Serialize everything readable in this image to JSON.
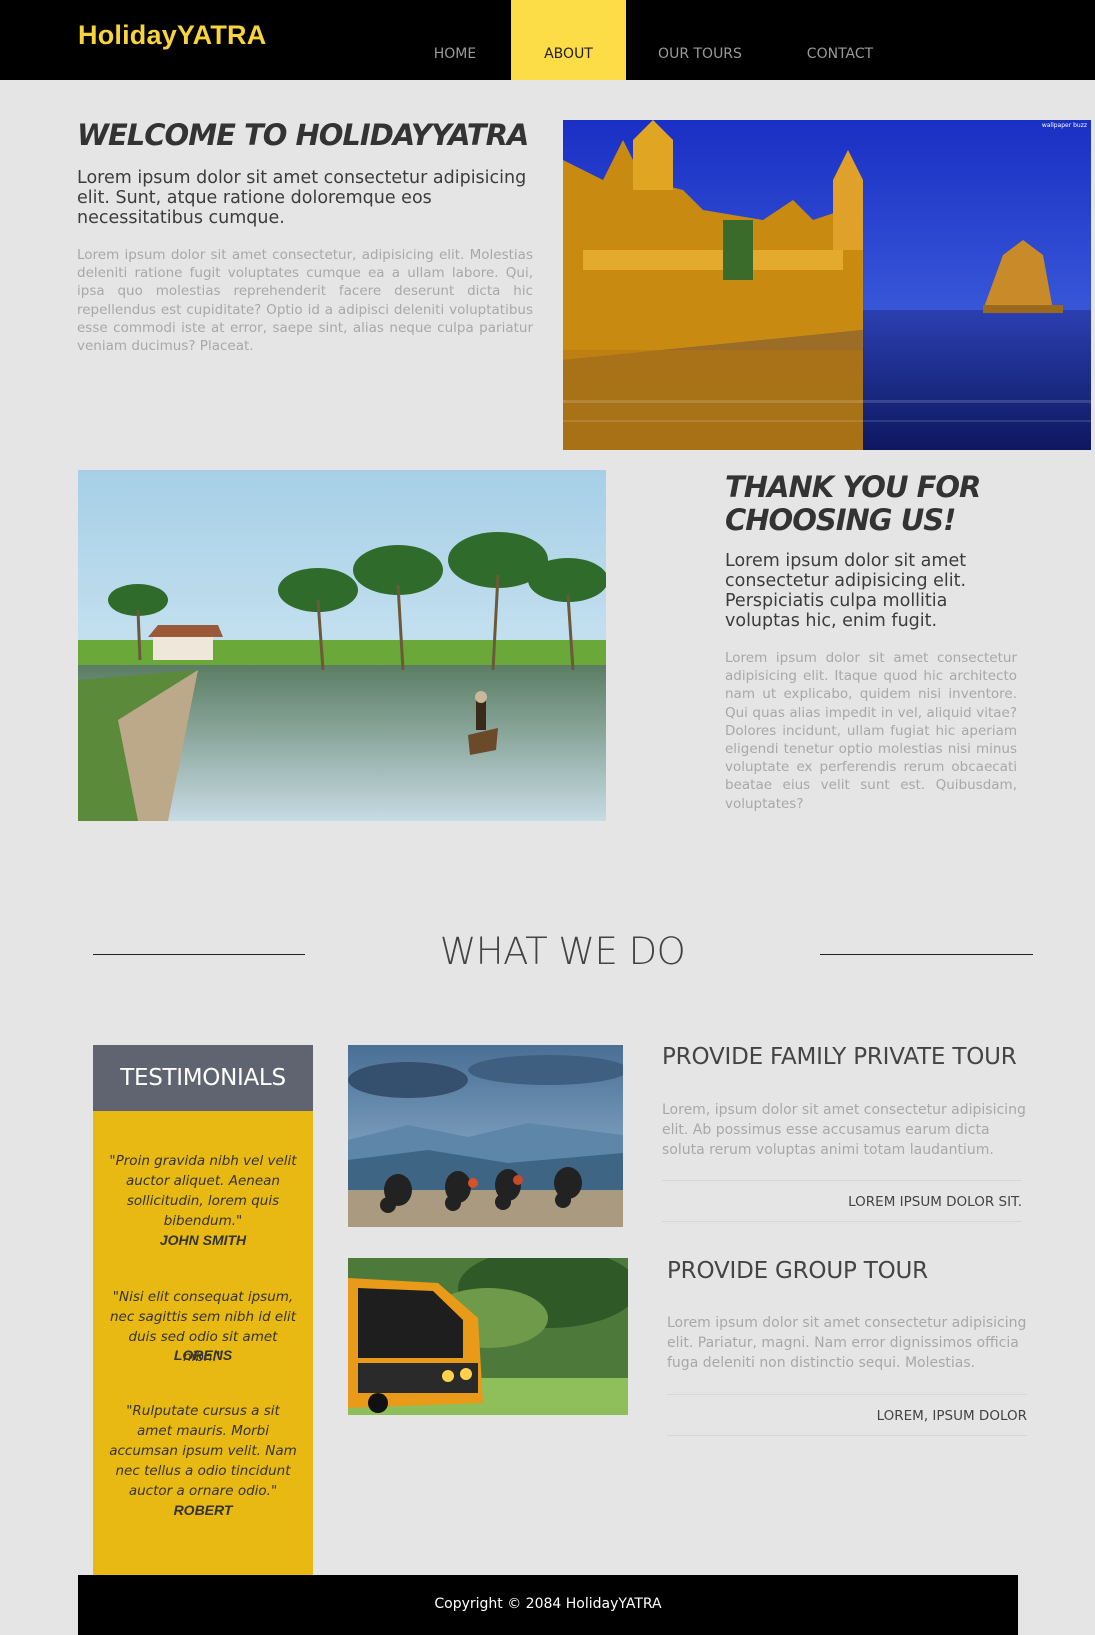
{
  "header": {
    "logo": "HolidayYATRA",
    "nav": [
      {
        "label": "HOME",
        "active": false
      },
      {
        "label": "ABOUT",
        "active": true
      },
      {
        "label": "OUR TOURS",
        "active": false
      },
      {
        "label": "CONTACT",
        "active": false
      }
    ]
  },
  "welcome": {
    "title": "WELCOME TO HOLIDAYYATRA",
    "lead": "Lorem ipsum dolor sit amet consectetur adipisicing elit. Sunt, atque ratione doloremque eos necessitatibus cumque.",
    "body": "Lorem ipsum dolor sit amet consectetur, adipisicing elit. Molestias deleniti ratione fugit voluptates cumque ea a ullam labore. Qui, ipsa quo molestias reprehenderit facere deserunt dicta hic repellendus est cupiditate? Optio id a adipisci deleniti voluptatibus esse commodi iste at error, saepe sint, alias neque culpa pariatur veniam ducimus? Placeat.",
    "image_watermark": "wallpaper buzz"
  },
  "thanks": {
    "title_line1": "THANK YOU FOR",
    "title_line2": "CHOOSING US!",
    "lead": "Lorem ipsum dolor sit amet consectetur adipisicing elit. Perspiciatis culpa mollitia voluptas hic, enim fugit.",
    "body": "Lorem ipsum dolor sit amet consectetur adipisicing elit. Itaque quod hic architecto nam ut explicabo, quidem nisi inventore. Qui quas alias impedit in vel, aliquid vitae? Dolores incidunt, ullam fugiat hic aperiam eligendi tenetur optio molestias nisi minus voluptate ex perferendis rerum obcaecati beatae eius velit sunt est. Quibusdam, voluptates?"
  },
  "what_we_do": {
    "title": "WHAT WE DO"
  },
  "testimonials": {
    "title": "TESTIMONIALS",
    "items": [
      {
        "quote": "\"Proin gravida nibh vel velit auctor aliquet. Aenean sollicitudin, lorem quis bibendum.\"",
        "author": "JOHN SMITH"
      },
      {
        "quote": "\"Nisi elit consequat ipsum, nec sagittis sem nibh id elit duis sed odio sit amet nibh.\"",
        "author": "LORENS"
      },
      {
        "quote": "\"Rulputate cursus a sit amet mauris. Morbi accumsan ipsum velit. Nam nec tellus a odio tincidunt auctor a ornare odio.\"",
        "author": "ROBERT"
      }
    ]
  },
  "tours": [
    {
      "title": "PROVIDE FAMILY PRIVATE TOUR",
      "text": "Lorem, ipsum dolor sit amet consectetur adipisicing elit. Ab possimus esse accusamus earum dicta soluta rerum voluptas animi totam laudantium.",
      "link": "LOREM IPSUM DOLOR SIT."
    },
    {
      "title": "PROVIDE GROUP TOUR",
      "text": "Lorem ipsum dolor sit amet consectetur adipisicing elit. Pariatur, magni. Nam error dignissimos officia fuga deleniti non distinctio sequi. Molestias.",
      "link": "LOREM, IPSUM DOLOR"
    }
  ],
  "footer": {
    "copyright": "Copyright © 2084 HolidayYATRA"
  },
  "colors": {
    "accent_yellow": "#fcdc47",
    "testimonial_yellow": "#e9b913",
    "testimonial_header": "#5f6470",
    "header_bg": "#000000",
    "page_bg": "#e5e5e5"
  }
}
